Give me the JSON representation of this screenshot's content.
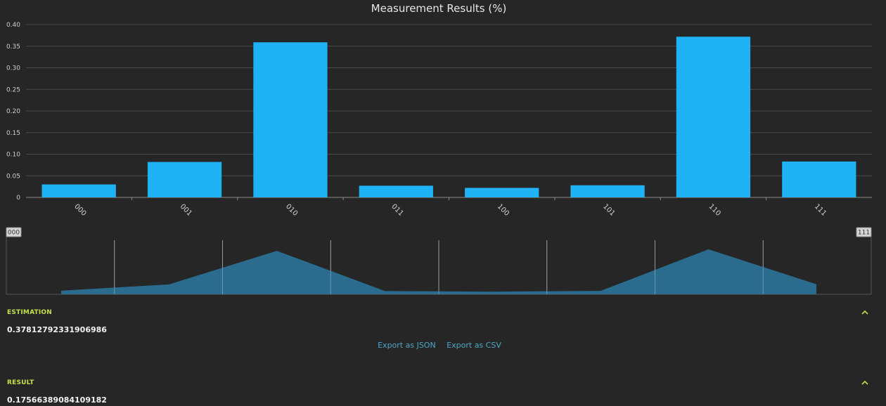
{
  "chart_data": {
    "type": "bar",
    "title": "Measurement Results (%)",
    "categories": [
      "000",
      "001",
      "010",
      "011",
      "100",
      "101",
      "110",
      "111"
    ],
    "values": [
      0.03,
      0.082,
      0.359,
      0.027,
      0.022,
      0.028,
      0.372,
      0.083
    ],
    "ylim": [
      0,
      0.4
    ],
    "yticks": [
      "0",
      "0.05",
      "0.10",
      "0.15",
      "0.20",
      "0.25",
      "0.30",
      "0.35",
      "0.40"
    ],
    "grid": true,
    "bar_color": "#1fb2f5"
  },
  "navigator": {
    "start_label": "000",
    "end_label": "111",
    "area_color": "#2a6f93"
  },
  "estimation": {
    "header": "ESTIMATION",
    "value": "0.37812792331906986"
  },
  "export": {
    "json_label": "Export as JSON",
    "csv_label": "Export as CSV"
  },
  "result": {
    "header": "RESULT",
    "value": "0.17566389084109182"
  },
  "colors": {
    "background": "#262626",
    "accent": "#c3e04a",
    "link": "#4ba8c8"
  }
}
